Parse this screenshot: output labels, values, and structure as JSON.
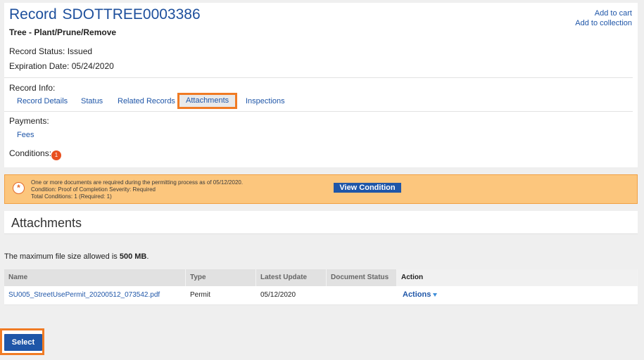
{
  "record": {
    "title_prefix": "Record",
    "record_id": "SDOTTREE0003386",
    "type": "Tree - Plant/Prune/Remove",
    "status_label": "Record Status:",
    "status_value": "Issued",
    "expiration_label": "Expiration Date:",
    "expiration_value": "05/24/2020"
  },
  "header_links": {
    "add_to_cart": "Add to cart",
    "add_to_collection": "Add to collection"
  },
  "record_info": {
    "label": "Record Info:",
    "tabs": [
      {
        "label": "Record Details"
      },
      {
        "label": "Status"
      },
      {
        "label": "Related Records"
      },
      {
        "label": "Attachments",
        "active": true
      },
      {
        "label": "Inspections"
      }
    ]
  },
  "payments": {
    "label": "Payments:",
    "fees": "Fees"
  },
  "conditions": {
    "label": "Conditions:",
    "count": "1"
  },
  "condition_banner": {
    "line1": "One or more documents are required during the permitting process as of 05/12/2020.",
    "line2": "Condition:  Proof of Completion    Severity:  Required",
    "line3": "Total Conditions: 1  (Required: 1)",
    "button": "View Condition",
    "icon": "alert-star-icon",
    "background_color": "#fcc67d"
  },
  "attachments": {
    "heading": "Attachments",
    "max_size_prefix": "The maximum file size allowed is ",
    "max_size_value": "500 MB",
    "max_size_suffix": ".",
    "columns": [
      "Name",
      "Type",
      "Latest Update",
      "Document Status",
      "Action"
    ],
    "rows": [
      {
        "name": "SU005_StreetUsePermit_20200512_073542.pdf",
        "type": "Permit",
        "latest_update": "05/12/2020",
        "document_status": "",
        "action": "Actions"
      }
    ]
  },
  "footer": {
    "select_button": "Select"
  },
  "colors": {
    "accent": "#1f56a8",
    "highlight": "#f07b24"
  }
}
